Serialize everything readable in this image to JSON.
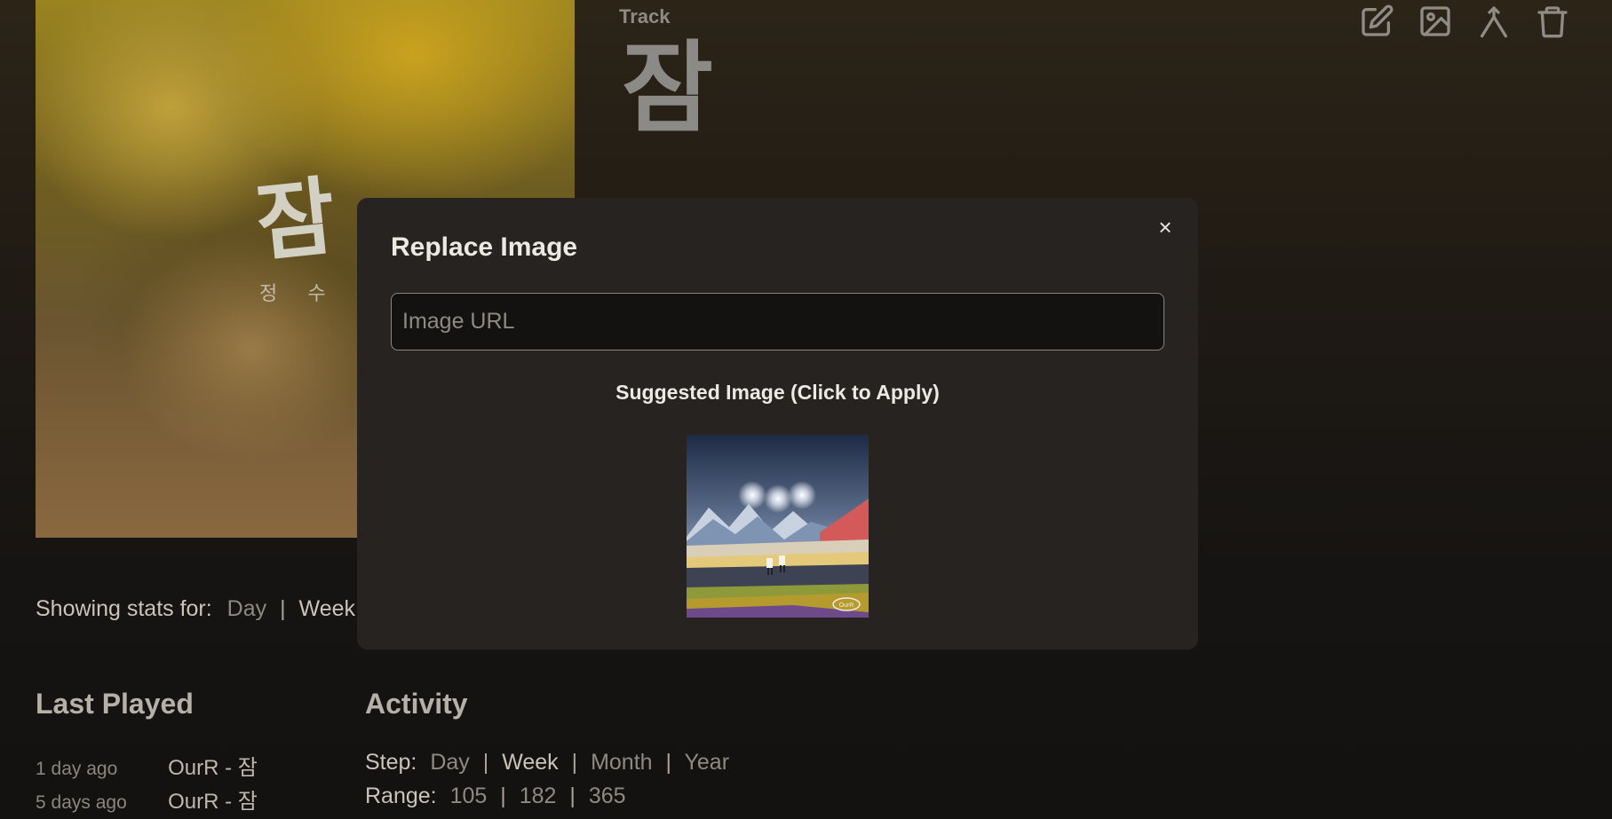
{
  "header": {
    "type_label": "Track",
    "title": "잠"
  },
  "cover": {
    "title": "잠",
    "artist": "정 수 훈"
  },
  "toolbar": {
    "items": [
      {
        "icon": "edit-icon"
      },
      {
        "icon": "image-icon"
      },
      {
        "icon": "merge-icon"
      },
      {
        "icon": "trash-icon"
      }
    ]
  },
  "stats": {
    "label": "Showing stats for:",
    "options": [
      "Day",
      "Week"
    ],
    "trailing_separator": "|"
  },
  "last_played": {
    "title": "Last Played",
    "rows": [
      {
        "time": "1 day ago",
        "track": "OurR - 잠"
      },
      {
        "time": "5 days ago",
        "track": "OurR - 잠"
      }
    ]
  },
  "activity": {
    "title": "Activity",
    "step_label": "Step:",
    "step_options": [
      "Day",
      "Week",
      "Month",
      "Year"
    ],
    "range_label": "Range:",
    "range_options": [
      "105",
      "182",
      "365"
    ]
  },
  "modal": {
    "title": "Replace Image",
    "close": "×",
    "input_placeholder": "Image URL",
    "input_value": "",
    "suggest_label": "Suggested Image (Click to Apply)",
    "suggest_badge": "OurR"
  },
  "colors": {
    "modal_bg": "#272321",
    "page_bg": "#1f1a14",
    "text_muted": "#8e8981"
  }
}
